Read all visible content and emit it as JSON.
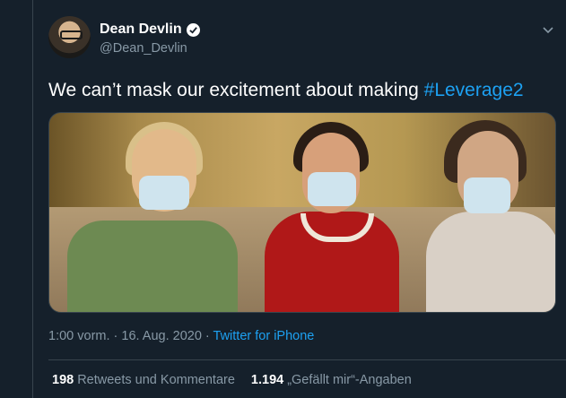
{
  "tweet": {
    "author": {
      "name": "Dean Devlin",
      "handle": "@Dean_Devlin",
      "verified_icon": "verified-badge-icon"
    },
    "text": "We can’t mask our excitement about making ",
    "hashtag": "#Leverage2",
    "timestamp": "1:00 vorm. · 16. Aug. 2020 · ",
    "source": "Twitter for iPhone",
    "stats": {
      "retweets_count": "198",
      "retweets_label": "Retweets und Kommentare",
      "likes_count": "1.194",
      "likes_label": "„Gefällt mir“-Angaben"
    }
  },
  "colors": {
    "background": "#15202b",
    "accent": "#1da1f2",
    "secondary_text": "#8899a6",
    "divider": "#38444d"
  }
}
